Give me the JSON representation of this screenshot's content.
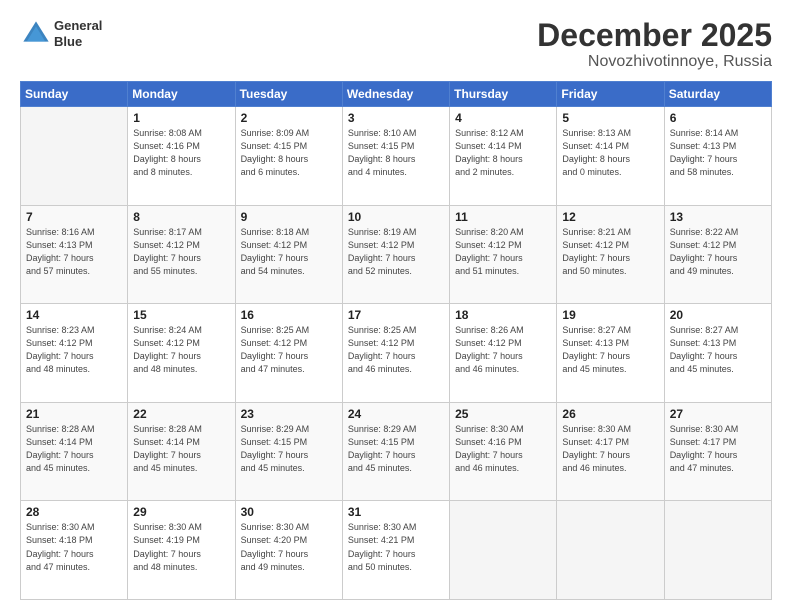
{
  "header": {
    "logo_line1": "General",
    "logo_line2": "Blue",
    "title": "December 2025",
    "subtitle": "Novozhivotinnoye, Russia"
  },
  "days_of_week": [
    "Sunday",
    "Monday",
    "Tuesday",
    "Wednesday",
    "Thursday",
    "Friday",
    "Saturday"
  ],
  "weeks": [
    [
      {
        "day": "",
        "info": ""
      },
      {
        "day": "1",
        "info": "Sunrise: 8:08 AM\nSunset: 4:16 PM\nDaylight: 8 hours\nand 8 minutes."
      },
      {
        "day": "2",
        "info": "Sunrise: 8:09 AM\nSunset: 4:15 PM\nDaylight: 8 hours\nand 6 minutes."
      },
      {
        "day": "3",
        "info": "Sunrise: 8:10 AM\nSunset: 4:15 PM\nDaylight: 8 hours\nand 4 minutes."
      },
      {
        "day": "4",
        "info": "Sunrise: 8:12 AM\nSunset: 4:14 PM\nDaylight: 8 hours\nand 2 minutes."
      },
      {
        "day": "5",
        "info": "Sunrise: 8:13 AM\nSunset: 4:14 PM\nDaylight: 8 hours\nand 0 minutes."
      },
      {
        "day": "6",
        "info": "Sunrise: 8:14 AM\nSunset: 4:13 PM\nDaylight: 7 hours\nand 58 minutes."
      }
    ],
    [
      {
        "day": "7",
        "info": "Sunrise: 8:16 AM\nSunset: 4:13 PM\nDaylight: 7 hours\nand 57 minutes."
      },
      {
        "day": "8",
        "info": "Sunrise: 8:17 AM\nSunset: 4:12 PM\nDaylight: 7 hours\nand 55 minutes."
      },
      {
        "day": "9",
        "info": "Sunrise: 8:18 AM\nSunset: 4:12 PM\nDaylight: 7 hours\nand 54 minutes."
      },
      {
        "day": "10",
        "info": "Sunrise: 8:19 AM\nSunset: 4:12 PM\nDaylight: 7 hours\nand 52 minutes."
      },
      {
        "day": "11",
        "info": "Sunrise: 8:20 AM\nSunset: 4:12 PM\nDaylight: 7 hours\nand 51 minutes."
      },
      {
        "day": "12",
        "info": "Sunrise: 8:21 AM\nSunset: 4:12 PM\nDaylight: 7 hours\nand 50 minutes."
      },
      {
        "day": "13",
        "info": "Sunrise: 8:22 AM\nSunset: 4:12 PM\nDaylight: 7 hours\nand 49 minutes."
      }
    ],
    [
      {
        "day": "14",
        "info": "Sunrise: 8:23 AM\nSunset: 4:12 PM\nDaylight: 7 hours\nand 48 minutes."
      },
      {
        "day": "15",
        "info": "Sunrise: 8:24 AM\nSunset: 4:12 PM\nDaylight: 7 hours\nand 48 minutes."
      },
      {
        "day": "16",
        "info": "Sunrise: 8:25 AM\nSunset: 4:12 PM\nDaylight: 7 hours\nand 47 minutes."
      },
      {
        "day": "17",
        "info": "Sunrise: 8:25 AM\nSunset: 4:12 PM\nDaylight: 7 hours\nand 46 minutes."
      },
      {
        "day": "18",
        "info": "Sunrise: 8:26 AM\nSunset: 4:12 PM\nDaylight: 7 hours\nand 46 minutes."
      },
      {
        "day": "19",
        "info": "Sunrise: 8:27 AM\nSunset: 4:13 PM\nDaylight: 7 hours\nand 45 minutes."
      },
      {
        "day": "20",
        "info": "Sunrise: 8:27 AM\nSunset: 4:13 PM\nDaylight: 7 hours\nand 45 minutes."
      }
    ],
    [
      {
        "day": "21",
        "info": "Sunrise: 8:28 AM\nSunset: 4:14 PM\nDaylight: 7 hours\nand 45 minutes."
      },
      {
        "day": "22",
        "info": "Sunrise: 8:28 AM\nSunset: 4:14 PM\nDaylight: 7 hours\nand 45 minutes."
      },
      {
        "day": "23",
        "info": "Sunrise: 8:29 AM\nSunset: 4:15 PM\nDaylight: 7 hours\nand 45 minutes."
      },
      {
        "day": "24",
        "info": "Sunrise: 8:29 AM\nSunset: 4:15 PM\nDaylight: 7 hours\nand 45 minutes."
      },
      {
        "day": "25",
        "info": "Sunrise: 8:30 AM\nSunset: 4:16 PM\nDaylight: 7 hours\nand 46 minutes."
      },
      {
        "day": "26",
        "info": "Sunrise: 8:30 AM\nSunset: 4:17 PM\nDaylight: 7 hours\nand 46 minutes."
      },
      {
        "day": "27",
        "info": "Sunrise: 8:30 AM\nSunset: 4:17 PM\nDaylight: 7 hours\nand 47 minutes."
      }
    ],
    [
      {
        "day": "28",
        "info": "Sunrise: 8:30 AM\nSunset: 4:18 PM\nDaylight: 7 hours\nand 47 minutes."
      },
      {
        "day": "29",
        "info": "Sunrise: 8:30 AM\nSunset: 4:19 PM\nDaylight: 7 hours\nand 48 minutes."
      },
      {
        "day": "30",
        "info": "Sunrise: 8:30 AM\nSunset: 4:20 PM\nDaylight: 7 hours\nand 49 minutes."
      },
      {
        "day": "31",
        "info": "Sunrise: 8:30 AM\nSunset: 4:21 PM\nDaylight: 7 hours\nand 50 minutes."
      },
      {
        "day": "",
        "info": ""
      },
      {
        "day": "",
        "info": ""
      },
      {
        "day": "",
        "info": ""
      }
    ]
  ]
}
